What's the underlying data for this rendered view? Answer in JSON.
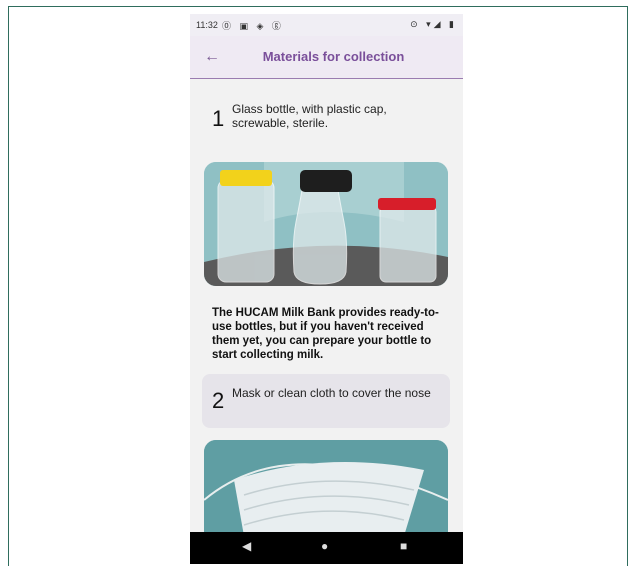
{
  "status_bar": {
    "time": "11:32",
    "left_icons": "⓪ ▣ ◈ ⓖ",
    "right_icons": "⊙ ▾◢ ▮"
  },
  "app_bar": {
    "back_icon": "←",
    "title": "Materials for collection"
  },
  "items": [
    {
      "number": "1",
      "text": "Glass bottle, with plastic cap, screwable, sterile."
    },
    {
      "number": "2",
      "text": "Mask or clean cloth to cover the nose"
    }
  ],
  "paragraph": "The HUCAM Milk Bank provides ready-to-use bottles, but if you haven't received them yet, you can prepare your bottle to start collecting milk.",
  "nav_bar": {
    "back": "◀",
    "home": "●",
    "recents": "■"
  },
  "colors": {
    "accent": "#7a4f9a",
    "app_bar_bg": "#efeaf3",
    "card_bg": "#e6e4ea",
    "image_teal": "#8fc0c4"
  }
}
